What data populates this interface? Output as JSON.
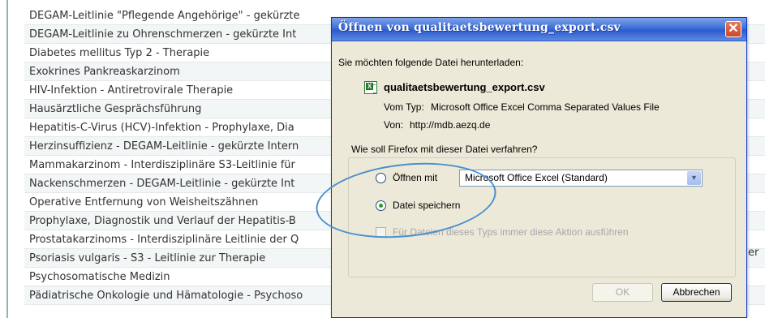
{
  "page": {
    "rows": [
      "DEGAM-Leitlinie \"Pflegende Angehörige\" - gekürzte",
      "DEGAM-Leitlinie zu Ohrenschmerzen - gekürzte Int",
      "Diabetes mellitus Typ 2 - Therapie",
      "Exokrines Pankreaskarzinom",
      "HIV-Infektion - Antiretrovirale Therapie",
      "Hausärztliche Gesprächsführung",
      "Hepatitis-C-Virus (HCV)-Infektion - Prophylaxe, Dia",
      "Herzinsuffizienz - DEGAM-Leitlinie - gekürzte Intern",
      "Mammakarzinom - Interdisziplinäre S3-Leitlinie für",
      "Nackenschmerzen - DEGAM-Leitlinie - gekürzte Int",
      "Operative Entfernung von Weisheitszähnen",
      "Prophylaxe, Diagnostik und Verlauf der Hepatitis-B",
      "Prostatakarzinoms - Interdisziplinäre Leitlinie der Q",
      "Psoriasis vulgaris - S3 - Leitlinie zur Therapie",
      "Psychosomatische Medizin",
      "Pädiatrische Onkologie und Hämatologie - Psychoso"
    ],
    "right_fragment": "er"
  },
  "dialog": {
    "title": "Öffnen von qualitaetsbewertung_export.csv",
    "close_label": "✕",
    "intro": "Sie möchten folgende Datei herunterladen:",
    "filename": "qualitaetsbewertung_export.csv",
    "type_label": "Vom Typ:",
    "type_value": "Microsoft Office Excel Comma Separated Values File",
    "from_label": "Von:",
    "from_value": "http://mdb.aezq.de",
    "question": "Wie soll Firefox mit dieser Datei verfahren?",
    "open_with_label": "Öffnen mit",
    "open_with_app": "Microsoft Office Excel (Standard)",
    "save_label": "Datei speichern",
    "remember_label": "Für Dateien dieses Typs immer diese Aktion ausführen",
    "ok_label": "OK",
    "cancel_label": "Abbrechen"
  },
  "colors": {
    "titlebar": "#2c5bcf",
    "dialog_bg": "#ece9d8",
    "annotation": "#4a8fd0"
  }
}
